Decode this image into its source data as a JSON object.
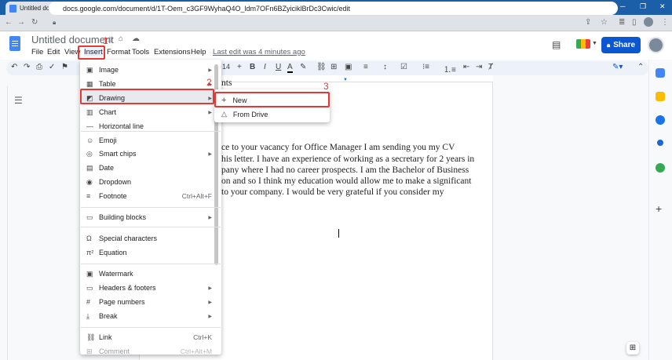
{
  "browser": {
    "tab_title": "Untitled document - Google Doc",
    "tab_close": "✕",
    "new_tab": "+",
    "url": "docs.google.com/document/d/1T-Oem_c3GF9WyhaQ4O_ldm7OFn6BZyiciklBrDc3Cwic/edit"
  },
  "docs": {
    "title": "Untitled document",
    "menus": [
      "File",
      "Edit",
      "View",
      "Insert",
      "Format",
      "Tools",
      "Extensions",
      "Help"
    ],
    "last_edit": "Last edit was 4 minutes ago",
    "share_label": "Share",
    "font_size": "14"
  },
  "insert_menu": {
    "items": [
      {
        "icon": "▣",
        "label": "Image",
        "shortcut": "",
        "submenu": true
      },
      {
        "icon": "▦",
        "label": "Table",
        "shortcut": "",
        "submenu": true
      },
      {
        "icon": "◩",
        "label": "Drawing",
        "shortcut": "",
        "submenu": true
      },
      {
        "icon": "▥",
        "label": "Chart",
        "shortcut": "",
        "submenu": true
      },
      {
        "icon": "—",
        "label": "Horizontal line",
        "shortcut": "",
        "submenu": false
      },
      {
        "icon": "☺",
        "label": "Emoji",
        "shortcut": "",
        "submenu": false
      },
      {
        "icon": "◎",
        "label": "Smart chips",
        "shortcut": "",
        "submenu": true
      },
      {
        "icon": "▤",
        "label": "Date",
        "shortcut": "",
        "submenu": false
      },
      {
        "icon": "◉",
        "label": "Dropdown",
        "shortcut": "",
        "submenu": false
      },
      {
        "icon": "≡",
        "label": "Footnote",
        "shortcut": "Ctrl+Alt+F",
        "submenu": false
      },
      {
        "icon": "▭",
        "label": "Building blocks",
        "shortcut": "",
        "submenu": true
      },
      {
        "icon": "Ω",
        "label": "Special characters",
        "shortcut": "",
        "submenu": false
      },
      {
        "icon": "π²",
        "label": "Equation",
        "shortcut": "",
        "submenu": false
      },
      {
        "icon": "▣",
        "label": "Watermark",
        "shortcut": "",
        "submenu": false
      },
      {
        "icon": "▭",
        "label": "Headers & footers",
        "shortcut": "",
        "submenu": true
      },
      {
        "icon": "#",
        "label": "Page numbers",
        "shortcut": "",
        "submenu": true
      },
      {
        "icon": "⤓",
        "label": "Break",
        "shortcut": "",
        "submenu": true
      },
      {
        "icon": "⛓",
        "label": "Link",
        "shortcut": "Ctrl+K",
        "submenu": false
      },
      {
        "icon": "⊞",
        "label": "Comment",
        "shortcut": "Ctrl+Alt+M",
        "submenu": false
      }
    ]
  },
  "drawing_submenu": {
    "new_label": "New",
    "from_drive_label": "From Drive"
  },
  "annotations": {
    "step1": "1",
    "step2": "2",
    "step3": "3"
  },
  "document": {
    "lines": [
      "nts",
      "ce to your vacancy for Office Manager I am sending you my CV",
      "his letter. I have an experience of working as a secretary for 2 years in",
      "pany where I had no career prospects. I am the Bachelor of Business",
      "on and so I think my education would allow me to make a significant",
      "to your company. I would be very grateful if you consider my"
    ]
  }
}
